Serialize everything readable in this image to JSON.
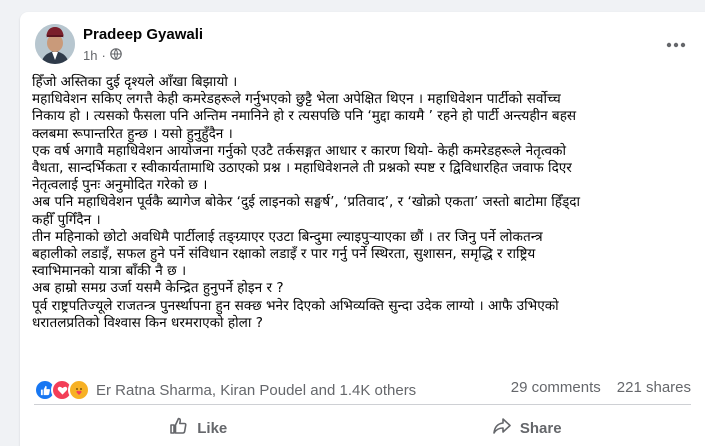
{
  "post": {
    "author": "Pradeep Gyawali",
    "time": "1h",
    "audience_icon": "globe-icon",
    "more_icon": "more-dots-icon",
    "lines": [
      "हिँजो अस्तिका दुई दृश्यले आँखा बिझायो ।",
      "महाधिवेशन सकिए लगत्तै केही कमरेडहरूले गर्नुभएको छुट्टै भेला अपेक्षित थिएन । महाधिवेशन पार्टीको सर्वोच्च",
      "निकाय हो । त्यसको फैसला पनि अन्तिम नमानिने हो र त्यसपछि पनि ‘मुद्दा कायमै ’ रहने हो पार्टी अन्त्यहीन बहस",
      "क्लबमा रूपान्तरित हुन्छ । यसो हुनुहुँदैन ।",
      "एक वर्ष अगावै महाधिवेशन आयोजना गर्नुको एउटै तर्कसङ्गत आधार र कारण थियो- केही कमरेडहरूले नेतृत्वको",
      "वैधता, सान्दर्भिकता र स्वीकार्यतामाथि उठाएको प्रश्न । महाधिवेशनले ती प्रश्नको स्पष्ट र द्विविधारहित जवाफ दिएर",
      "नेतृत्वलाई पुनः अनुमोदित गरेको छ ।",
      "अब पनि महाधिवेशन पूर्वकै ब्यागेज बोकेर ‘दुई लाइनको सङ्घर्ष’, ‘प्रतिवाद’, र ‘खोक्रो एकता’ जस्तो बाटोमा हिँड्दा",
      "कहीँ पुगिँदैन ।",
      "तीन महिनाको छोटो अवधिमै पार्टीलाई तङ्ग्र्याएर एउटा बिन्दुमा ल्याइपुर्‍याएका छौं । तर जिनु पर्ने लोकतन्त्र",
      "बहालीको लडाइँ, सफल हुने पर्ने संविधान रक्षाको लडाइँ र पार गर्नु पर्ने स्थिरता, सुशासन, समृद्धि र राष्ट्रिय",
      "स्वाभिमानको यात्रा बाँकी नै छ ।",
      "अब हाम्रो समग्र उर्जा यसमै केन्द्रित हुनुपर्ने होइन र ?",
      "पूर्व राष्ट्रपतिज्यूले राजतन्त्र पुनर्स्थापना हुन सक्छ भनेर दिएको अभिव्यक्ति सुन्दा उदेक लाग्यो । आफै उभिएको",
      "धरातलप्रतिको विश्वास किन धरमराएको होला ?"
    ]
  },
  "stats": {
    "reaction_icons": [
      "like-icon",
      "love-icon",
      "care-icon"
    ],
    "reactors": "Er Ratna Sharma, Kiran Poudel and 1.4K others",
    "comments": "29 comments",
    "shares": "221 shares"
  },
  "actions": {
    "like_label": "Like",
    "share_label": "Share"
  },
  "colors": {
    "page_bg": "#f0f2f5",
    "card_bg": "#ffffff",
    "text": "#050505",
    "secondary_text": "#65676b",
    "like_blue": "#1877f2",
    "love_red": "#f33e58",
    "care_yellow": "#f7b125"
  }
}
